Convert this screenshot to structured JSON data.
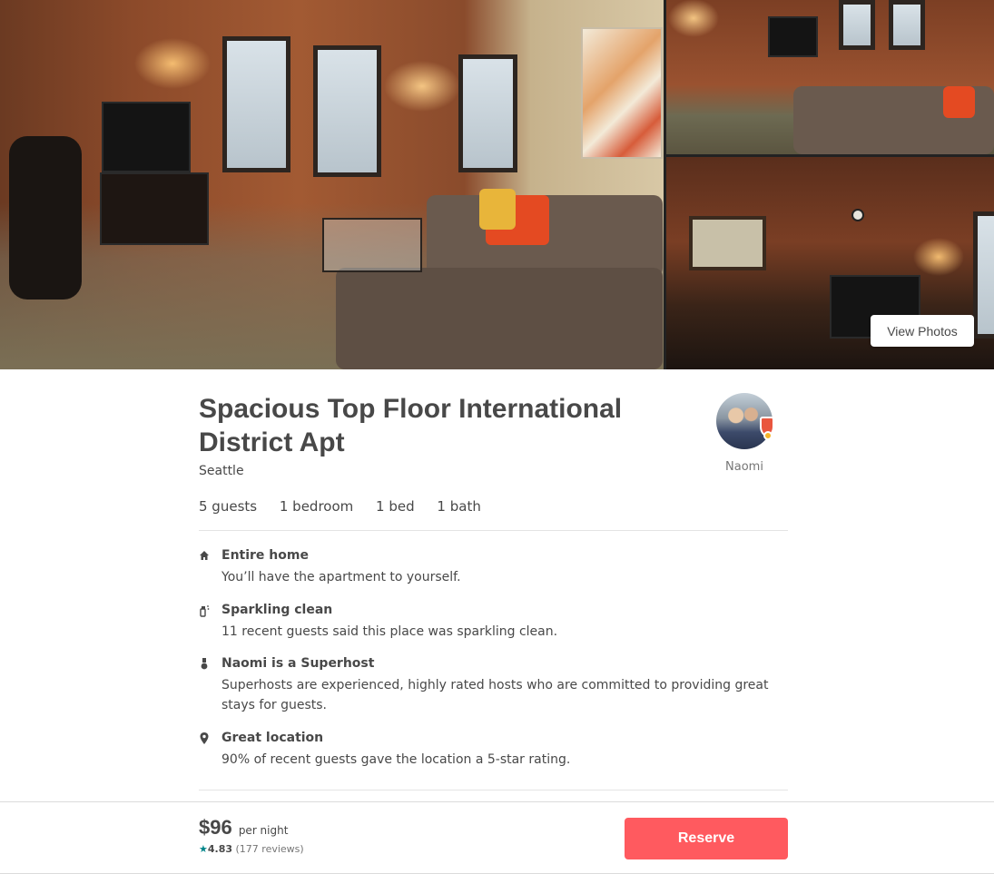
{
  "gallery": {
    "view_photos_label": "View Photos"
  },
  "listing": {
    "title": "Spacious Top Floor International District Apt",
    "city": "Seattle",
    "specs": [
      "5 guests",
      "1 bedroom",
      "1 bed",
      "1 bath"
    ]
  },
  "host": {
    "name": "Naomi",
    "badge_icon": "superhost-badge-icon"
  },
  "highlights": [
    {
      "icon": "home-icon",
      "title": "Entire home",
      "description": "You’ll have the apartment to yourself."
    },
    {
      "icon": "cleaning-spray-icon",
      "title": "Sparkling clean",
      "description": "11 recent guests said this place was sparkling clean."
    },
    {
      "icon": "superhost-medal-icon",
      "title": "Naomi is a Superhost",
      "description": "Superhosts are experienced, highly rated hosts who are committed to providing great stays for guests."
    },
    {
      "icon": "location-pin-icon",
      "title": "Great location",
      "description": "90% of recent guests gave the location a 5-star rating."
    }
  ],
  "booking": {
    "price": "$96",
    "price_unit": "per night",
    "star": "★",
    "rating": "4.83",
    "reviews": "(177 reviews)",
    "reserve_label": "Reserve"
  },
  "colors": {
    "accent": "#ff5a5f",
    "text": "#484848",
    "star": "#008489"
  }
}
